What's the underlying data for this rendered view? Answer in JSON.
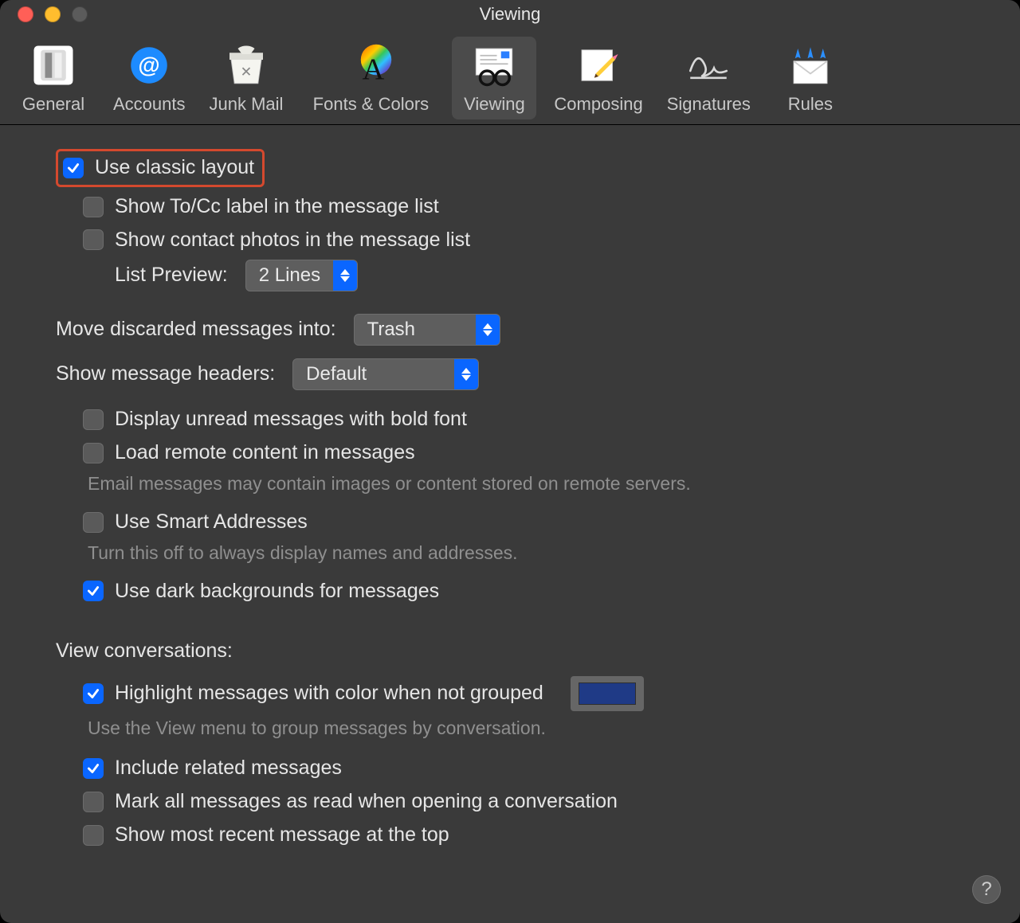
{
  "window": {
    "title": "Viewing"
  },
  "toolbar": {
    "items": [
      {
        "label": "General"
      },
      {
        "label": "Accounts"
      },
      {
        "label": "Junk Mail"
      },
      {
        "label": "Fonts & Colors"
      },
      {
        "label": "Viewing"
      },
      {
        "label": "Composing"
      },
      {
        "label": "Signatures"
      },
      {
        "label": "Rules"
      }
    ]
  },
  "settings": {
    "classic_layout": "Use classic layout",
    "show_tocc": "Show To/Cc label in the message list",
    "show_photos": "Show contact photos in the message list",
    "list_preview_label": "List Preview:",
    "list_preview_value": "2 Lines",
    "move_discarded_label": "Move discarded messages into:",
    "move_discarded_value": "Trash",
    "show_headers_label": "Show message headers:",
    "show_headers_value": "Default",
    "display_unread_bold": "Display unread messages with bold font",
    "load_remote": "Load remote content in messages",
    "load_remote_hint": "Email messages may contain images or content stored on remote servers.",
    "smart_addresses": "Use Smart Addresses",
    "smart_addresses_hint": "Turn this off to always display names and addresses.",
    "dark_bg": "Use dark backgrounds for messages"
  },
  "conversations": {
    "heading": "View conversations:",
    "highlight": "Highlight messages with color when not grouped",
    "highlight_hint": "Use the View menu to group messages by conversation.",
    "highlight_color": "#1f3a86",
    "include_related": "Include related messages",
    "mark_read": "Mark all messages as read when opening a conversation",
    "most_recent_top": "Show most recent message at the top"
  },
  "help": "?"
}
